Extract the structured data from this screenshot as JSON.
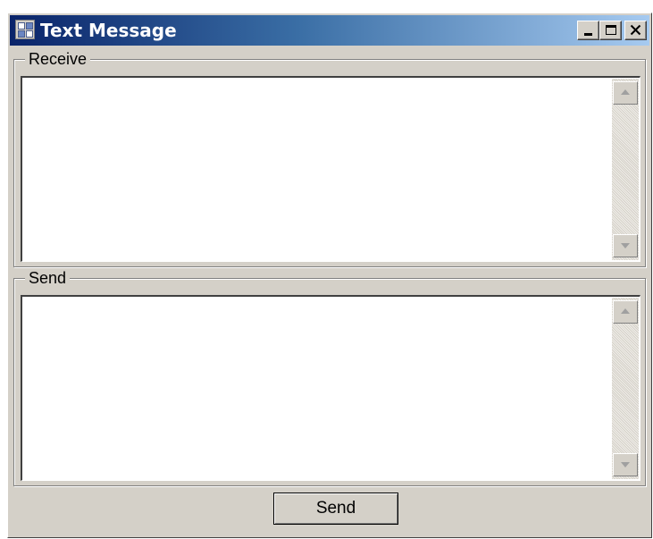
{
  "window": {
    "title": "Text Message"
  },
  "titlebar_buttons": {
    "minimize_icon": "minimize-icon",
    "maximize_icon": "maximize-icon",
    "close_icon": "close-icon"
  },
  "receive": {
    "label": "Receive",
    "text": ""
  },
  "send_group": {
    "label": "Send",
    "text": ""
  },
  "send_button": {
    "label": "Send"
  },
  "colors": {
    "titlebar_start": "#0a246a",
    "titlebar_end": "#a6caf0",
    "window_face": "#d4d0c8"
  }
}
